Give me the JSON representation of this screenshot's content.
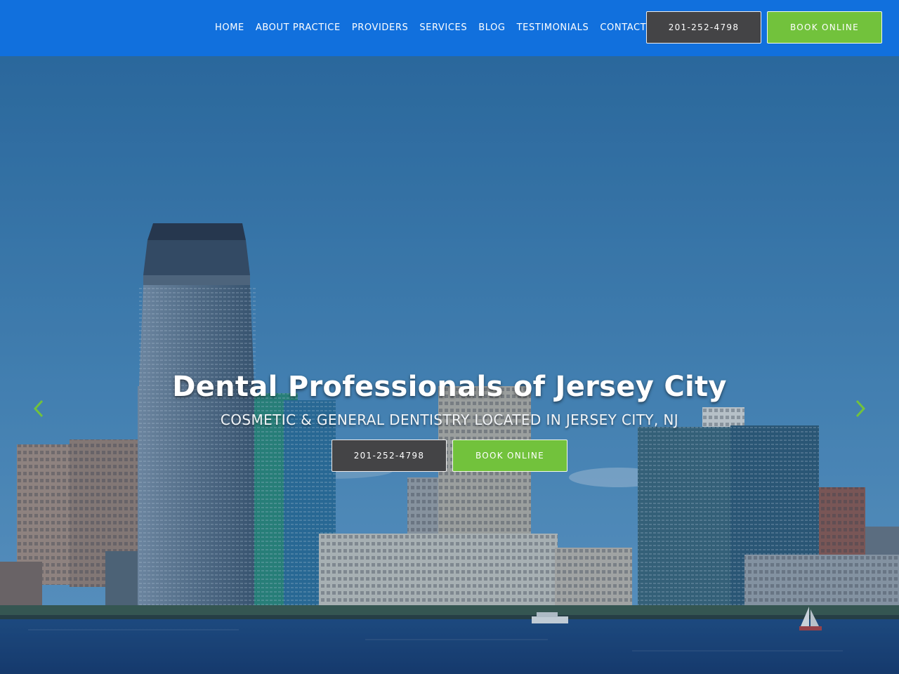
{
  "nav": {
    "items": [
      "HOME",
      "ABOUT PRACTICE",
      "PROVIDERS",
      "SERVICES",
      "BLOG",
      "TESTIMONIALS",
      "CONTACT"
    ],
    "phone_label": "201-252-4798",
    "book_label": "BOOK ONLINE"
  },
  "hero": {
    "title": "Dental Professionals of Jersey City",
    "subtitle": "COSMETIC & GENERAL DENTISTRY LOCATED IN JERSEY CITY, NJ",
    "phone_label": "201-252-4798",
    "book_label": "BOOK ONLINE",
    "prev_icon": "chevron-left-icon",
    "next_icon": "chevron-right-icon"
  },
  "colors": {
    "header": "#1170dd",
    "dark_button": "#444446",
    "green_button": "#72c23c",
    "arrow": "#72c23c"
  }
}
